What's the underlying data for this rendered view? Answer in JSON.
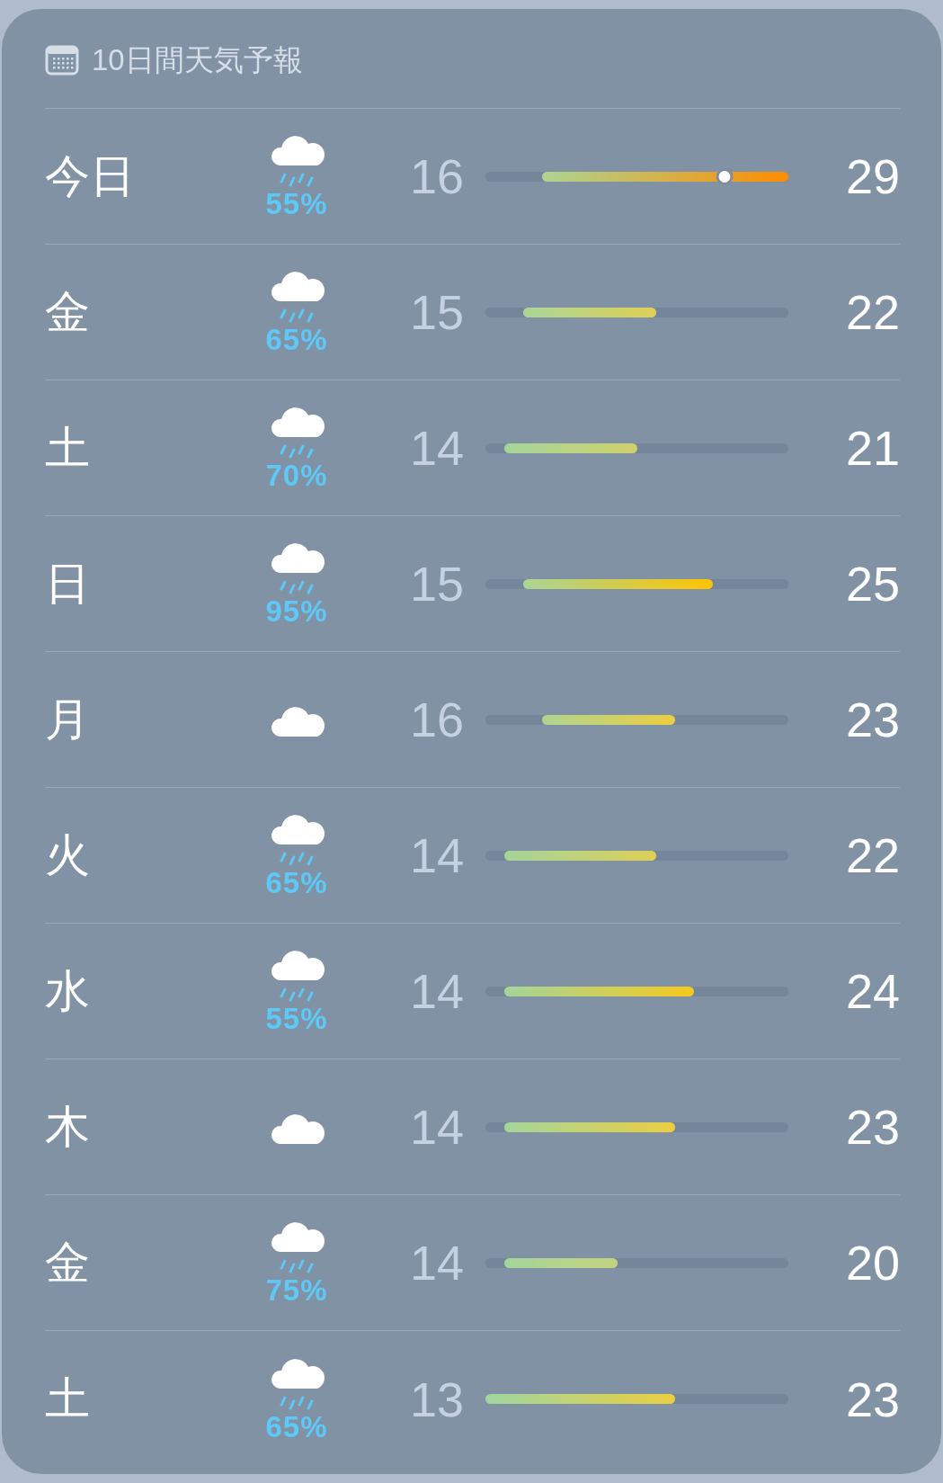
{
  "header": {
    "title": "10日間天気予報"
  },
  "days": [
    {
      "day": "今日",
      "kind": "rain",
      "precip": "55%",
      "low": "16",
      "high": "29",
      "current": {
        "level": 0.79
      }
    },
    {
      "day": "金",
      "kind": "rain",
      "precip": "65%",
      "low": "15",
      "high": "22"
    },
    {
      "day": "土",
      "kind": "rain",
      "precip": "70%",
      "low": "14",
      "high": "21"
    },
    {
      "day": "日",
      "kind": "rain",
      "precip": "95%",
      "low": "15",
      "high": "25"
    },
    {
      "day": "月",
      "kind": "cloud",
      "low": "16",
      "high": "23"
    },
    {
      "day": "火",
      "kind": "rain",
      "precip": "65%",
      "low": "14",
      "high": "22"
    },
    {
      "day": "水",
      "kind": "rain",
      "precip": "55%",
      "low": "14",
      "high": "24"
    },
    {
      "day": "木",
      "kind": "cloud",
      "low": "14",
      "high": "23"
    },
    {
      "day": "金",
      "kind": "rain",
      "precip": "75%",
      "low": "14",
      "high": "20"
    },
    {
      "day": "土",
      "kind": "rain",
      "precip": "65%",
      "low": "13",
      "high": "23"
    }
  ]
}
